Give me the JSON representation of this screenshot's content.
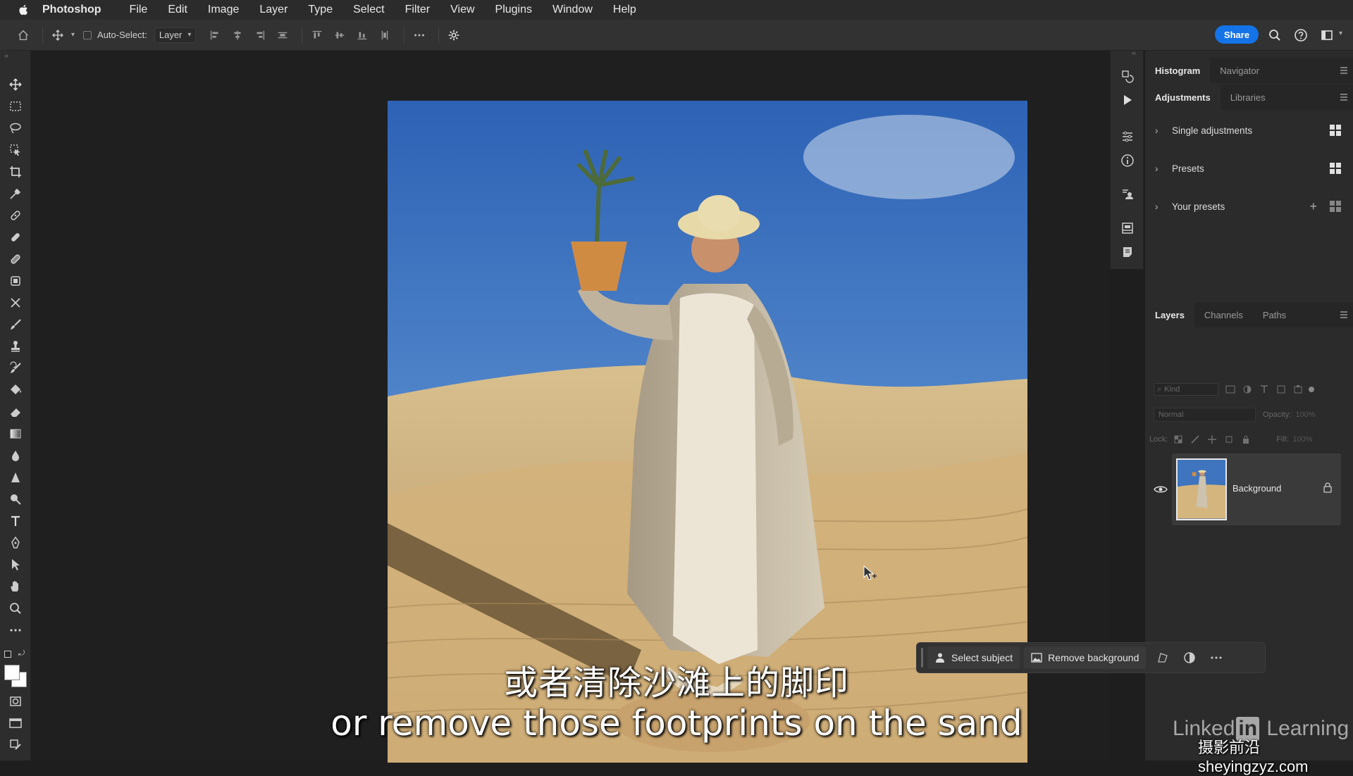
{
  "menubar": {
    "app_name": "Photoshop",
    "items": [
      "File",
      "Edit",
      "Image",
      "Layer",
      "Type",
      "Select",
      "Filter",
      "View",
      "Plugins",
      "Window",
      "Help"
    ]
  },
  "options_bar": {
    "auto_select_label": "Auto-Select:",
    "auto_select_value": "Layer",
    "share_label": "Share"
  },
  "toolbar": {
    "tools": [
      "move-tool",
      "rectangular-marquee-tool",
      "lasso-tool",
      "object-selection-tool",
      "crop-tool",
      "eyedropper-tool",
      "spot-healing-tool",
      "healing-brush-tool",
      "patch-tool",
      "content-aware-move-tool",
      "remove-tool",
      "brush-tool",
      "clone-stamp-tool",
      "history-brush-tool",
      "paint-bucket-tool",
      "eraser-tool",
      "gradient-tool",
      "blur-tool",
      "sharpen-tool",
      "dodge-tool",
      "type-tool",
      "pen-tool",
      "path-selection-tool",
      "hand-tool",
      "zoom-tool",
      "more-tools"
    ]
  },
  "panels": {
    "top_tabs": [
      "Histogram",
      "Navigator"
    ],
    "adj_tabs": [
      "Adjustments",
      "Libraries"
    ],
    "adjustments": [
      {
        "label": "Single adjustments"
      },
      {
        "label": "Presets"
      },
      {
        "label": "Your presets"
      }
    ],
    "layer_tabs": [
      "Layers",
      "Channels",
      "Paths"
    ],
    "filter_placeholder": "Kind",
    "blend_mode": "Normal",
    "opacity_label": "Opacity:",
    "opacity_value": "100%",
    "lock_label": "Lock:",
    "fill_label": "Fill:",
    "fill_value": "100%",
    "layer_name": "Background"
  },
  "contextual_bar": {
    "select_subject": "Select subject",
    "remove_background": "Remove background"
  },
  "subtitles": {
    "chinese": "或者清除沙滩上的脚印",
    "english": "or remove those footprints on the sand"
  },
  "branding": {
    "linkedin_a": "Linked",
    "linkedin_b": "in",
    "linkedin_c": " Learning",
    "watermark": "摄影前沿 sheyingzyz.com"
  },
  "colors": {
    "accent": "#1473e6",
    "panel_bg": "#2b2b2b",
    "sky": "#3a6fb8",
    "sand": "#d4b57e"
  }
}
